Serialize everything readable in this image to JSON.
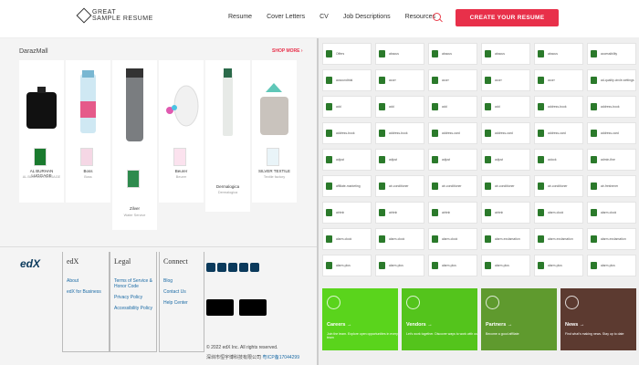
{
  "header": {
    "logo_line1": "GREAT",
    "logo_line2": "SAMPLE RESUME",
    "nav": [
      "Resume",
      "Cover Letters",
      "CV",
      "Job Descriptions",
      "Resources"
    ],
    "cta": "CREATE YOUR RESUME"
  },
  "daraz": {
    "title": "DarazMall",
    "shop_more": "SHOP MORE",
    "products": [
      {
        "name": "AL BURHAN LUGGAGE",
        "brand": "AL BURHAN LUGGAGE"
      },
      {
        "name": "Boss",
        "brand": "Boss"
      },
      {
        "name": "Zilver",
        "brand": "Water Service"
      },
      {
        "name": "Beurer",
        "brand": "Beurer"
      },
      {
        "name": "Dermalogica",
        "brand": "Dermalogica"
      },
      {
        "name": "SILVER TEXTILE",
        "brand": "Textile factory"
      }
    ]
  },
  "footer": {
    "edx_logo": "edX",
    "col1": {
      "title": "edX",
      "links": [
        "About",
        "edX for Business"
      ]
    },
    "col2": {
      "title": "Legal",
      "links": [
        "Terms of Service & Honor Code",
        "Privacy Policy",
        "Accessibility Policy"
      ]
    },
    "col3": {
      "title": "Connect",
      "links": [
        "Blog",
        "Contact Us",
        "Help Center"
      ]
    },
    "copyright": "© 2022 edX Inc. All rights reserved.",
    "icp": "深圳市恒宇博科技有限公司",
    "icp_link": "粤ICP备17044299"
  },
  "icons": [
    "Offers",
    "abacus",
    "abacus",
    "abacus",
    "abacus",
    "accessibility",
    "acsoundtrial",
    "acorn",
    "acorn",
    "acorn",
    "acorn",
    "ad-quality-circle-settings",
    "add",
    "add",
    "add",
    "add",
    "address-book",
    "address-book",
    "address-book",
    "address-book",
    "address-card",
    "address-card",
    "address-card",
    "address-card",
    "adjust",
    "adjust",
    "adjust",
    "adjust",
    "aclock",
    "admin-fine",
    "affiliate-marketing",
    "air-conditioner",
    "air-conditioner",
    "air-conditioner",
    "air-conditioner",
    "air-freshener",
    "airbnb",
    "airbnb",
    "airbnb",
    "airbnb",
    "alarm-clock",
    "alarm-clock",
    "alarm-clock",
    "alarm-clock",
    "alarm-clock",
    "alarm-exclamation",
    "alarm-exclamation",
    "alarm-exclamation",
    "alarm-plus",
    "alarm-plus",
    "alarm-plus",
    "alarm-plus",
    "alarm-plus",
    "alarm-plus"
  ],
  "cards": [
    {
      "title": "Careers →",
      "desc": "Join the team. Explore open opportunities in every team",
      "color": "#5ad41c"
    },
    {
      "title": "Vendors →",
      "desc": "Let's work together. Discover ways to work with us",
      "color": "#54c41c"
    },
    {
      "title": "Partners →",
      "desc": "Become a good affiliate",
      "color": "#5f9a2e"
    },
    {
      "title": "News →",
      "desc": "Find what's making news. Stay up to date",
      "color": "#5c3a30"
    }
  ]
}
